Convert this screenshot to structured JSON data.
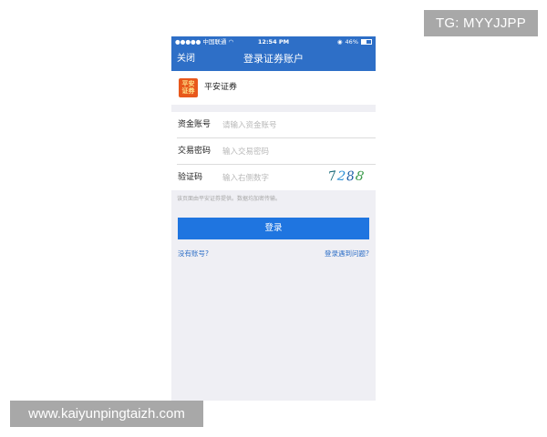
{
  "watermarks": {
    "top": "TG: MYYJJPP",
    "bottom": "www.kaiyunpingtaizh.com"
  },
  "status_bar": {
    "carrier": "●●●●● 中国联通 ",
    "time": "12:54 PM",
    "battery_text": "46%",
    "battery_level": 0.46,
    "wifi_icon": "wifi-icon",
    "lock_icon": "orientation-lock-icon"
  },
  "nav": {
    "close_label": "关闭",
    "title": "登录证券账户"
  },
  "brand": {
    "logo_text": "平安证券",
    "name": "平安证券"
  },
  "form": {
    "account": {
      "label": "资金账号",
      "placeholder": "请输入资金账号",
      "value": ""
    },
    "password": {
      "label": "交易密码",
      "placeholder": "输入交易密码",
      "value": ""
    },
    "captcha": {
      "label": "验证码",
      "placeholder": "输入右侧数字",
      "value": "",
      "image_text": "7288"
    }
  },
  "notice": "该页面由平安证券提供。数据均加密传输。",
  "login_button": "登录",
  "links": {
    "no_account": "没有账号?",
    "login_problem": "登录遇到问题?"
  },
  "colors": {
    "nav_blue": "#2e6fc7",
    "button_blue": "#1f75e0",
    "background": "#efeff4",
    "logo_orange": "#e8581c"
  }
}
